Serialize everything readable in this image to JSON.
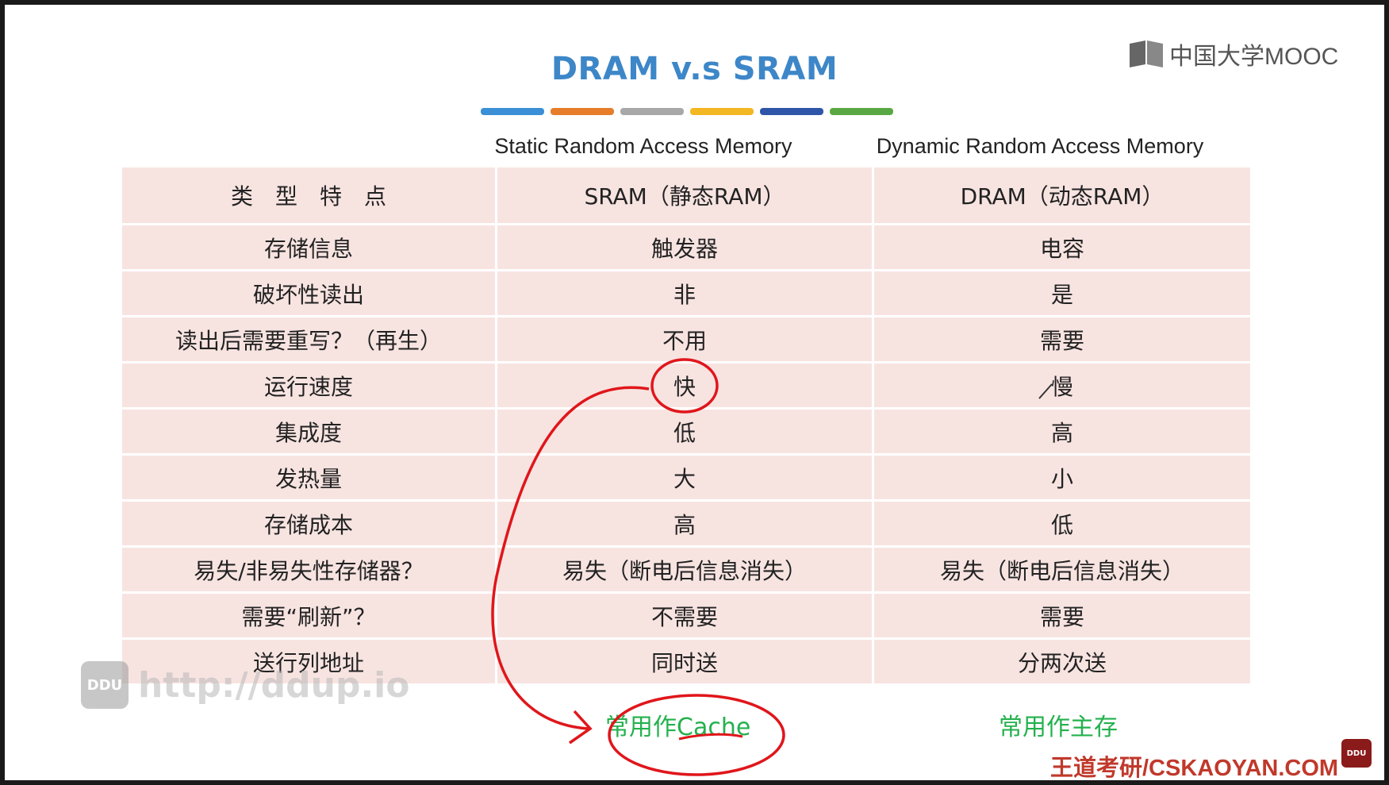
{
  "slide": {
    "title": "DRAM v.s SRAM",
    "logo_text": "中国大学MOOC",
    "color_bar": [
      "#3a8fd6",
      "#e57d2a",
      "#a8a8a8",
      "#f2b722",
      "#2f55a8",
      "#5aa843"
    ],
    "col_sram_full": "Static Random Access Memory",
    "col_dram_full": "Dynamic Random Access Memory"
  },
  "table": {
    "header": [
      "类　型　特　点",
      "SRAM（静态RAM）",
      "DRAM（动态RAM）"
    ],
    "rows": [
      [
        "存储信息",
        "触发器",
        "电容"
      ],
      [
        "破坏性读出",
        "非",
        "是"
      ],
      [
        "读出后需要重写？（再生）",
        "不用",
        "需要"
      ],
      [
        "运行速度",
        "快",
        "慢"
      ],
      [
        "集成度",
        "低",
        "高"
      ],
      [
        "发热量",
        "大",
        "小"
      ],
      [
        "存储成本",
        "高",
        "低"
      ],
      [
        "易失/非易失性存储器？",
        "易失（断电后信息消失）",
        "易失（断电后信息消失）"
      ],
      [
        "需要“刷新”？",
        "不需要",
        "需要"
      ],
      [
        "送行列地址",
        "同时送",
        "分两次送"
      ]
    ]
  },
  "notes": {
    "sram_use": "常用作Cache",
    "dram_use": "常用作主存"
  },
  "watermark": {
    "badge": "DDU",
    "text": "http://ddup.io"
  },
  "brand": "王道考研/CSKAOYAN.COM",
  "chip": "DDU",
  "colors": {
    "title": "#3d87c8",
    "cell_bg": "#f7e4e1",
    "note": "#23b14d",
    "ink": "#e0161b",
    "brand": "#c0392b"
  }
}
